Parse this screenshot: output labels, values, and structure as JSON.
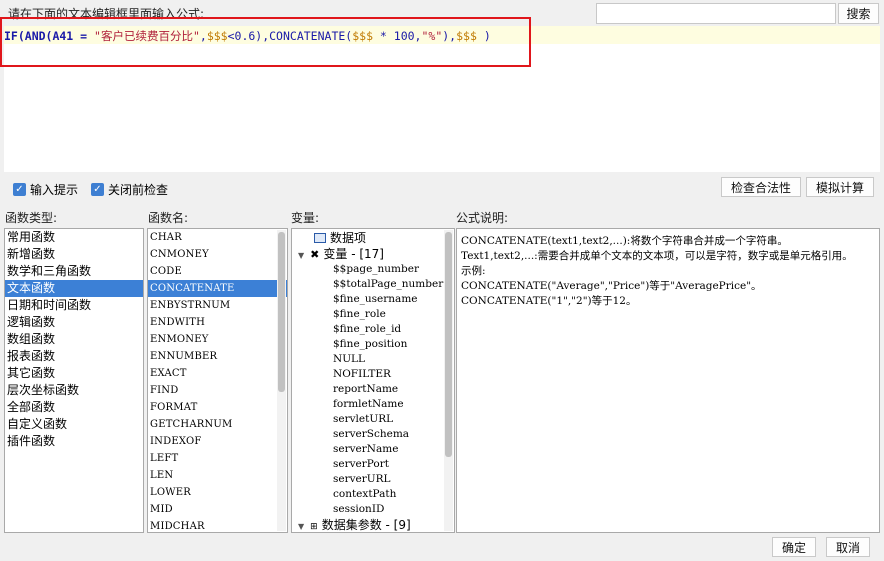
{
  "prompt_label": "请在下面的文本编辑框里面输入公式:",
  "search_button": "搜索",
  "formula": {
    "p1": "IF(AND(A41 = ",
    "s1": "\"客户已续费百分比\"",
    "p2": ",",
    "v1": "$$$",
    "p3": "<0.6),CONCATENATE(",
    "v2": "$$$",
    "p4": " * 100,",
    "s2": "\"%\"",
    "p5": "),",
    "v3": "$$$",
    "p6": " )"
  },
  "options": {
    "input_hint": "输入提示",
    "check_before_close": "关闭前检查"
  },
  "buttons": {
    "check_validity": "检查合法性",
    "simulate": "模拟计算",
    "ok": "确定",
    "cancel": "取消"
  },
  "labels": {
    "function_type": "函数类型:",
    "function_name": "函数名:",
    "variables": "变量:",
    "formula_desc": "公式说明:"
  },
  "function_types": [
    "常用函数",
    "新增函数",
    "数学和三角函数",
    "文本函数",
    "日期和时间函数",
    "逻辑函数",
    "数组函数",
    "报表函数",
    "其它函数",
    "层次坐标函数",
    "全部函数",
    "自定义函数",
    "插件函数"
  ],
  "function_types_selected": 3,
  "function_names": [
    "CHAR",
    "CNMONEY",
    "CODE",
    "CONCATENATE",
    "ENBYSTRNUM",
    "ENDWITH",
    "ENMONEY",
    "ENNUMBER",
    "EXACT",
    "FIND",
    "FORMAT",
    "GETCHARNUM",
    "INDEXOF",
    "LEFT",
    "LEN",
    "LOWER",
    "MID",
    "MIDCHAR"
  ],
  "function_names_selected": 3,
  "variables": {
    "data_item": "数据项",
    "var_group": "变量 - [17]",
    "var_items": [
      "$$page_number",
      "$$totalPage_number",
      "$fine_username",
      "$fine_role",
      "$fine_role_id",
      "$fine_position",
      "NULL",
      "NOFILTER",
      "reportName",
      "formletName",
      "servletURL",
      "serverSchema",
      "serverName",
      "serverPort",
      "serverURL",
      "contextPath",
      "sessionID"
    ],
    "dataset_params": "数据集参数 - [9]"
  },
  "description": [
    "CONCATENATE(text1,text2,...):将数个字符串合并成一个字符串。",
    "Text1,text2,...:需要合并成单个文本的文本项，可以是字符，数字或是单元格引用。",
    "示例:",
    "CONCATENATE(\"Average\",\"Price\")等于\"AveragePrice\"。",
    "CONCATENATE(\"1\",\"2\")等于12。"
  ],
  "colors": {
    "selection": "#3c80d6",
    "highlight_box": "#e0161b",
    "string_literal": "#b0203a",
    "keyword": "#1a1aa8",
    "variable": "#c07a00"
  }
}
